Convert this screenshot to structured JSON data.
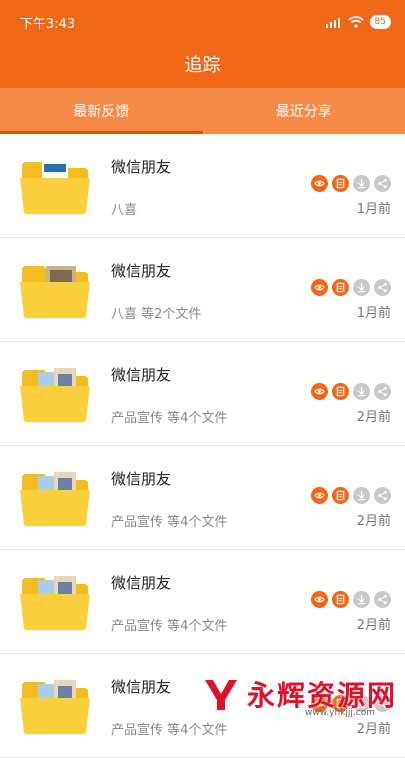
{
  "status_bar": {
    "time": "下午3:43",
    "battery": "85"
  },
  "header": {
    "title": "追踪"
  },
  "tabs": [
    {
      "label": "最新反馈",
      "active": true
    },
    {
      "label": "最近分享",
      "active": false
    }
  ],
  "items": [
    {
      "name": "微信朋友",
      "subtitle": "八喜",
      "time": "1月前",
      "folder_icon": "folder-with-doc-icon"
    },
    {
      "name": "微信朋友",
      "subtitle": "八喜 等2个文件",
      "time": "1月前",
      "folder_icon": "folder-with-photo-icon"
    },
    {
      "name": "微信朋友",
      "subtitle": "产品宣传 等4个文件",
      "time": "2月前",
      "folder_icon": "folder-with-photos-icon"
    },
    {
      "name": "微信朋友",
      "subtitle": "产品宣传 等4个文件",
      "time": "2月前",
      "folder_icon": "folder-with-photos-icon"
    },
    {
      "name": "微信朋友",
      "subtitle": "产品宣传 等4个文件",
      "time": "2月前",
      "folder_icon": "folder-with-photos-icon"
    },
    {
      "name": "微信朋友",
      "subtitle": "产品宣传 等4个文件",
      "time": "2月前",
      "folder_icon": "folder-with-photos-icon"
    }
  ],
  "actions": [
    "eye-icon",
    "document-icon",
    "download-icon",
    "share-icon"
  ],
  "watermark": {
    "text": "永辉资源网",
    "url": "www.yhkjjj.com"
  },
  "colors": {
    "accent": "#ef6717",
    "tab_bar": "#f4894a",
    "inactive": "#c8c8c8"
  }
}
